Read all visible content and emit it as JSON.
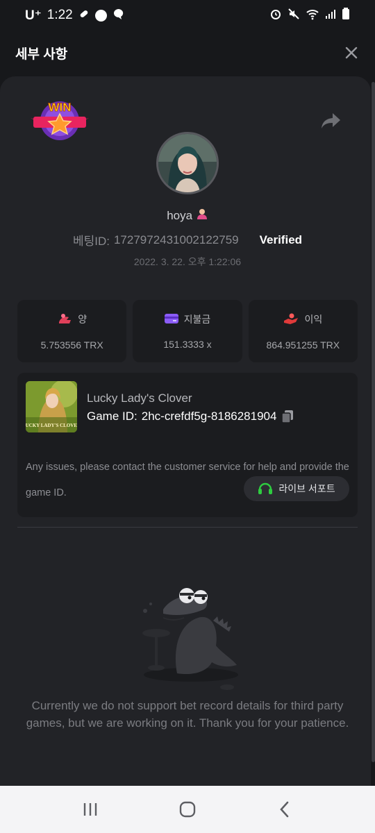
{
  "status_bar": {
    "carrier": "U⁺",
    "time": "1:22"
  },
  "header": {
    "title": "세부 사항"
  },
  "profile": {
    "username": "hoya",
    "bet_id_label": "베팅ID:",
    "bet_id": "1727972431002122759",
    "verified": "Verified",
    "timestamp": "2022. 3. 22. 오후 1:22:06"
  },
  "stats": [
    {
      "label": "양",
      "value": "5.753556 TRX",
      "icon": "coins-icon",
      "color": "#e0405a"
    },
    {
      "label": "지불금",
      "value": "151.3333 x",
      "icon": "wallet-icon",
      "color": "#8b5cf6"
    },
    {
      "label": "이익",
      "value": "864.951255 TRX",
      "icon": "profit-hand-icon",
      "color": "#e03a3a"
    }
  ],
  "game": {
    "title": "Lucky Lady's Clover",
    "id_label": "Game ID:",
    "id_value": "2hc-crefdf5g-8186281904",
    "help_text": "Any issues, please contact the customer service for help and provide the game ID.",
    "live_support_label": "라이브 서포트",
    "thumb_caption": "LUCKY LADY'S CLOVER"
  },
  "empty_state": {
    "message": "Currently we do not support bet record details for third party games, but we are working on it. Thank you for your patience."
  },
  "badge": {
    "text": "WIN"
  },
  "colors": {
    "panel_bg": "#222327",
    "card_bg": "#1b1c1f",
    "accent_green": "#2ecc40"
  }
}
